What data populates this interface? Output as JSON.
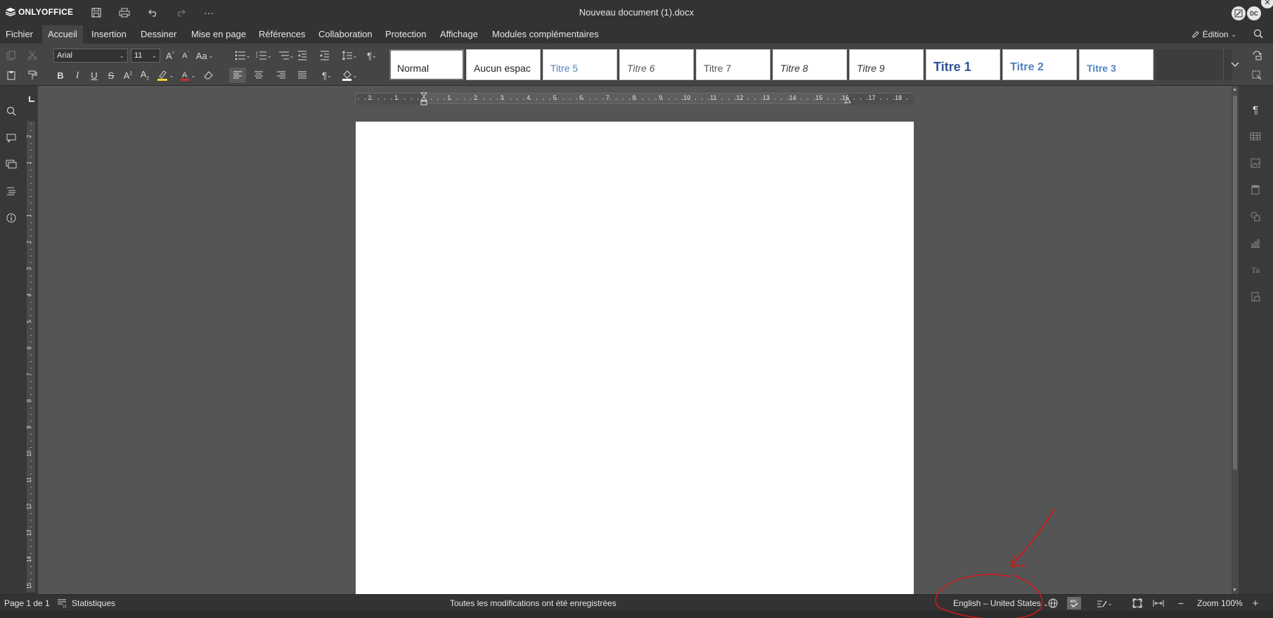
{
  "app": {
    "logo_text": "ONLYOFFICE",
    "doc_title": "Nouveau document (1).docx",
    "user_initials": "DC"
  },
  "menu": {
    "tabs": [
      {
        "label": "Fichier"
      },
      {
        "label": "Accueil"
      },
      {
        "label": "Insertion"
      },
      {
        "label": "Dessiner"
      },
      {
        "label": "Mise en page"
      },
      {
        "label": "Références"
      },
      {
        "label": "Collaboration"
      },
      {
        "label": "Protection"
      },
      {
        "label": "Affichage"
      },
      {
        "label": "Modules complémentaires"
      }
    ],
    "active_tab": "Accueil",
    "edit_mode_label": "Édition"
  },
  "toolbar": {
    "font_name": "Arial",
    "font_size": "11",
    "change_case_label": "Aa",
    "styles": [
      {
        "label": "Normal",
        "color": "#222222",
        "italic": false,
        "bold": false,
        "size": 14
      },
      {
        "label": "Aucun espac",
        "color": "#222222",
        "italic": false,
        "bold": false,
        "size": 14
      },
      {
        "label": "Titre 5",
        "color": "#4f81bd",
        "italic": false,
        "bold": false,
        "size": 14
      },
      {
        "label": "Titre 6",
        "color": "#555555",
        "italic": true,
        "bold": false,
        "size": 14
      },
      {
        "label": "Titre 7",
        "color": "#555555",
        "italic": false,
        "bold": false,
        "size": 14
      },
      {
        "label": "Titre 8",
        "color": "#333333",
        "italic": true,
        "bold": false,
        "size": 14
      },
      {
        "label": "Titre 9",
        "color": "#333333",
        "italic": true,
        "bold": false,
        "size": 14
      },
      {
        "label": "Titre 1",
        "color": "#2f5496",
        "italic": false,
        "bold": true,
        "size": 18
      },
      {
        "label": "Titre 2",
        "color": "#4f81bd",
        "italic": false,
        "bold": true,
        "size": 16
      },
      {
        "label": "Titre 3",
        "color": "#4f81bd",
        "italic": false,
        "bold": true,
        "size": 14
      }
    ]
  },
  "ruler": {
    "horizontal_labels": [
      "2",
      "1",
      "1",
      "2",
      "3",
      "4",
      "5",
      "6",
      "7",
      "8",
      "9",
      "10",
      "11",
      "12",
      "13",
      "14",
      "15",
      "16",
      "17",
      "18"
    ],
    "vertical_labels": [
      "2",
      "1",
      "1",
      "2",
      "3",
      "4",
      "5",
      "6",
      "7",
      "8",
      "9",
      "10",
      "11",
      "12",
      "13",
      "14",
      "15"
    ]
  },
  "status": {
    "page_info": "Page 1 de 1",
    "statistics_label": "Statistiques",
    "save_status": "Toutes les modifications ont été enregistrées",
    "language": "English – United States",
    "zoom_label": "Zoom 100%"
  },
  "colors": {
    "accent_highlight": "#f4d23a",
    "font_color_bar": "#d12b2b",
    "annotation_red": "#d01818",
    "avatar_bg": "#e6e6e6"
  }
}
